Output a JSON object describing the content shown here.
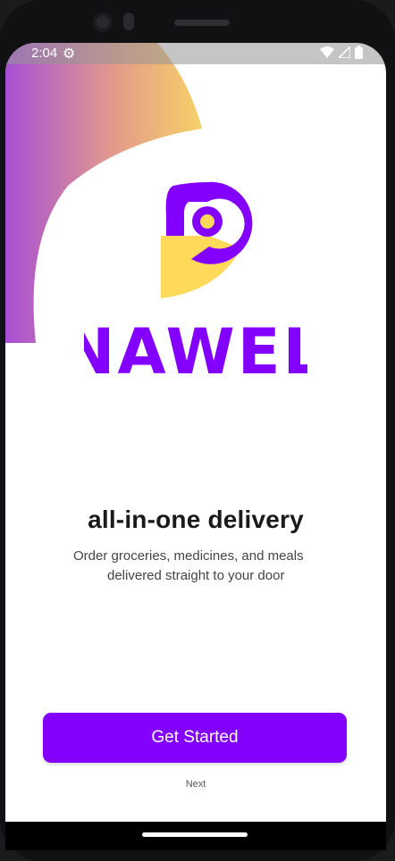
{
  "status_bar": {
    "time": "2:04",
    "settings_icon": "gear-icon",
    "wifi_icon": "wifi-icon",
    "signal_icon": "signal-icon",
    "battery_icon": "battery-icon"
  },
  "brand": {
    "name": "NAWEL",
    "primary_color": "#8300ff",
    "accent_color": "#ffd95a"
  },
  "onboarding": {
    "headline": "all-in-one delivery",
    "subtitle_line1": "Order groceries, medicines, and meals",
    "subtitle_line2": "delivered straight to your door",
    "cta_label": "Get Started",
    "next_label": "Next"
  }
}
